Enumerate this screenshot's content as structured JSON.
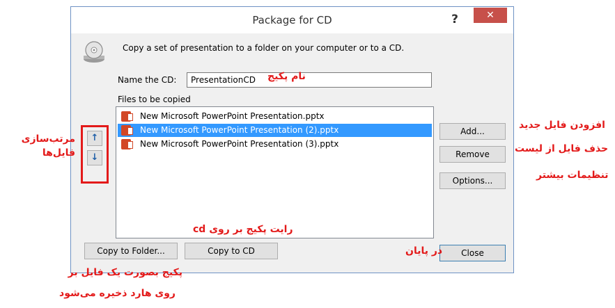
{
  "dialog": {
    "title": "Package for CD",
    "help": "?",
    "close": "✕",
    "description": "Copy a set of presentation to a folder on your computer or to a CD.",
    "name_label": "Name the CD:",
    "name_value": "PresentationCD",
    "files_label": "Files to be copied",
    "files": [
      "New Microsoft PowerPoint Presentation.pptx",
      "New Microsoft PowerPoint Presentation (2).pptx",
      "New Microsoft PowerPoint Presentation (3).pptx"
    ],
    "buttons": {
      "add": "Add...",
      "remove": "Remove",
      "options": "Options...",
      "copy_folder": "Copy to Folder...",
      "copy_cd": "Copy to CD",
      "close": "Close"
    },
    "arrow_up": "↑",
    "arrow_down": "↓"
  },
  "annotations": {
    "package_name": "نام پکیج",
    "add_file": "افزودن فایل جدید",
    "remove_file": "حذف فایل از لیست",
    "more_settings": "تنظیمات بیشتر",
    "sort_line1": "مرتب‌سازی",
    "sort_line2": "فایل‌ها",
    "write_cd": "رایت پکیج بر روی cd",
    "finally": "در پایان",
    "save_line1": "پکیج بصورت یک فایل بر",
    "save_line2": "روی هارد ذخیره می‌شود"
  },
  "colors": {
    "annotation": "#e31a1a",
    "selection": "#3399ff",
    "close_button": "#c7504a"
  }
}
